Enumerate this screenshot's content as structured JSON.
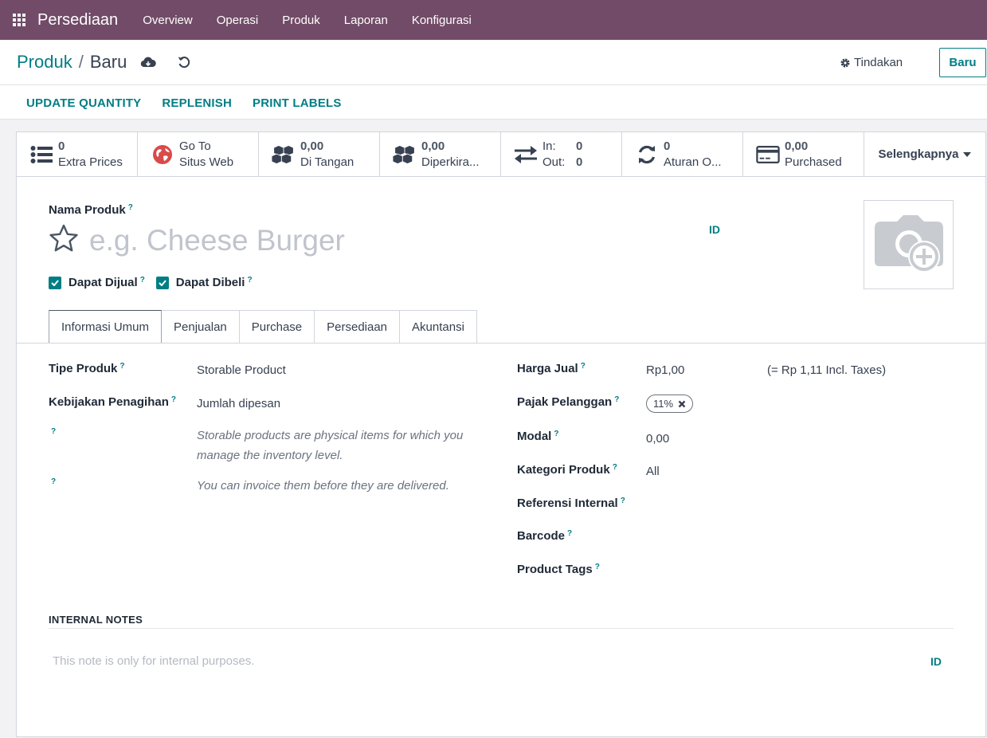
{
  "topnav": {
    "app_name": "Persediaan",
    "menu": [
      "Overview",
      "Operasi",
      "Produk",
      "Laporan",
      "Konfigurasi"
    ],
    "bg_color": "#714b67"
  },
  "breadcrumb": {
    "parent": "Produk",
    "separator": "/",
    "current": "Baru"
  },
  "control": {
    "actions_label": "Tindakan",
    "new_label": "Baru"
  },
  "header_buttons": [
    "UPDATE QUANTITY",
    "REPLENISH",
    "PRINT LABELS"
  ],
  "smart_buttons": {
    "extra_prices": {
      "value": "0",
      "label": "Extra Prices"
    },
    "website": {
      "line1": "Go To",
      "line2": "Situs Web"
    },
    "on_hand": {
      "value": "0,00",
      "label": "Di Tangan"
    },
    "forecast": {
      "value": "0,00",
      "label": "Diperkira..."
    },
    "in_out": {
      "in_label": "In:",
      "in_value": "0",
      "out_label": "Out:",
      "out_value": "0"
    },
    "rules": {
      "value": "0",
      "label": "Aturan O..."
    },
    "purchased": {
      "value": "0,00",
      "label": "Purchased"
    },
    "more": "Selengkapnya"
  },
  "product": {
    "name_label": "Nama Produk",
    "name_placeholder": "e.g. Cheese Burger",
    "lang_code": "ID",
    "help_mark": "?",
    "can_sell_label": "Dapat Dijual",
    "can_purchase_label": "Dapat Dibeli"
  },
  "tabs": [
    "Informasi Umum",
    "Penjualan",
    "Purchase",
    "Persediaan",
    "Akuntansi"
  ],
  "general": {
    "product_type_label": "Tipe Produk",
    "product_type_value": "Storable Product",
    "invoice_policy_label": "Kebijakan Penagihan",
    "invoice_policy_value": "Jumlah dipesan",
    "type_help": "Storable products are physical items for which you manage the inventory level.",
    "invoice_help": "You can invoice them before they are delivered.",
    "sales_price_label": "Harga Jual",
    "sales_price_value": "Rp1,00",
    "sales_price_incl": "(= Rp 1,11 Incl. Taxes)",
    "customer_tax_label": "Pajak Pelanggan",
    "customer_tax_value": "11%",
    "cost_label": "Modal",
    "cost_value": "0,00",
    "category_label": "Kategori Produk",
    "category_value": "All",
    "internal_ref_label": "Referensi Internal",
    "barcode_label": "Barcode",
    "tags_label": "Product Tags"
  },
  "notes": {
    "title": "INTERNAL NOTES",
    "placeholder": "This note is only for internal purposes.",
    "lang_code": "ID"
  }
}
